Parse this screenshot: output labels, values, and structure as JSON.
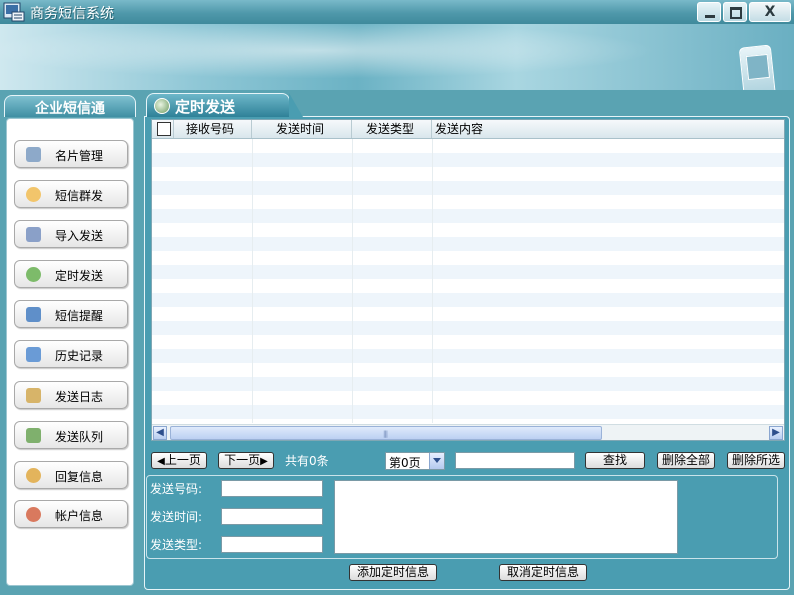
{
  "window": {
    "title": "商务短信系统",
    "close_glyph": "X"
  },
  "sidebar": {
    "title": "企业短信通",
    "items": [
      {
        "label": "名片管理",
        "icon": "contact-card-icon",
        "color": "#8da9c9"
      },
      {
        "label": "短信群发",
        "icon": "group-message-icon",
        "color": "#f2c56b"
      },
      {
        "label": "导入发送",
        "icon": "import-icon",
        "color": "#8aa0c8"
      },
      {
        "label": "定时发送",
        "icon": "timer-icon",
        "color": "#7dbb6a"
      },
      {
        "label": "短信提醒",
        "icon": "reminder-icon",
        "color": "#5f8fc9"
      },
      {
        "label": "历史记录",
        "icon": "history-icon",
        "color": "#6a9bd6"
      },
      {
        "label": "发送日志",
        "icon": "log-icon",
        "color": "#d7b469"
      },
      {
        "label": "发送队列",
        "icon": "queue-icon",
        "color": "#7fb06d"
      },
      {
        "label": "回复信息",
        "icon": "reply-icon",
        "color": "#e3b45c"
      },
      {
        "label": "帐户信息",
        "icon": "account-icon",
        "color": "#d9795e"
      }
    ]
  },
  "main": {
    "tab_label": "定时发送",
    "table": {
      "columns": [
        "接收号码",
        "发送时间",
        "发送类型",
        "发送内容"
      ],
      "rows": [],
      "scroll_grip": "|||"
    },
    "pager": {
      "prev_label": "上一页",
      "next_label": "下一页",
      "prev_arrow": "◀",
      "next_arrow": "▶",
      "total_text": "共有0条",
      "page_select_value": "第0页",
      "search_value": "",
      "search_label": "查找",
      "delete_all_label": "删除全部",
      "delete_selected_label": "删除所选"
    },
    "form": {
      "number_label": "发送号码:",
      "time_label": "发送时间:",
      "type_label": "发送类型:",
      "number_value": "",
      "time_value": "",
      "type_value": "",
      "content_value": ""
    },
    "actions": {
      "add_label": "添加定时信息",
      "cancel_label": "取消定时信息"
    }
  },
  "colors": {
    "row_alt": "#eef5fb",
    "row": "#ffffff",
    "panel": "#4a9db1"
  }
}
